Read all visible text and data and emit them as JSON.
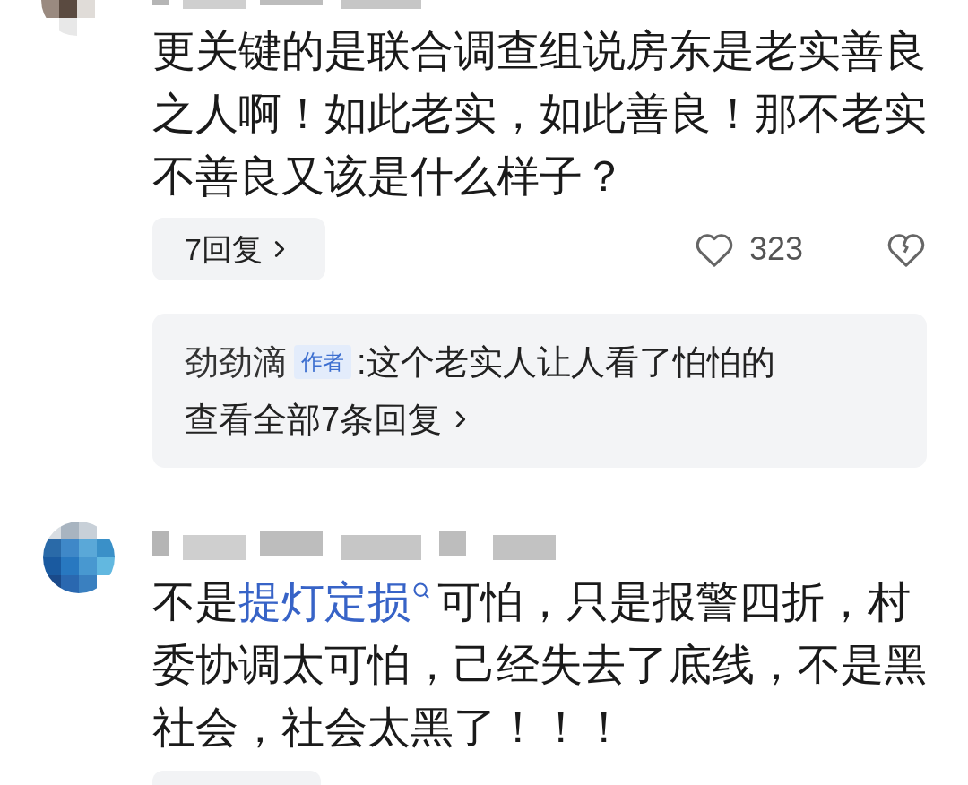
{
  "comments": [
    {
      "text": "更关键的是联合调查组说房东是老实善良之人啊！如此老实，如此善良！那不老实不善良又该是什么样子？",
      "replies_button": "7回复",
      "likes": "323",
      "reply_preview": {
        "author": "劲劲滴",
        "badge": "作者",
        "separator": ":",
        "text": "这个老实人让人看了怕怕的",
        "more": "查看全部7条回复"
      }
    },
    {
      "parts": [
        {
          "kind": "text",
          "text": "不是"
        },
        {
          "kind": "link",
          "text": "提灯定损"
        },
        {
          "kind": "text",
          "text": "可怕，只是报警四折，村委协调太可怕，己经失去了底线，不是黑社会，社会太黑了！！！"
        }
      ]
    }
  ]
}
